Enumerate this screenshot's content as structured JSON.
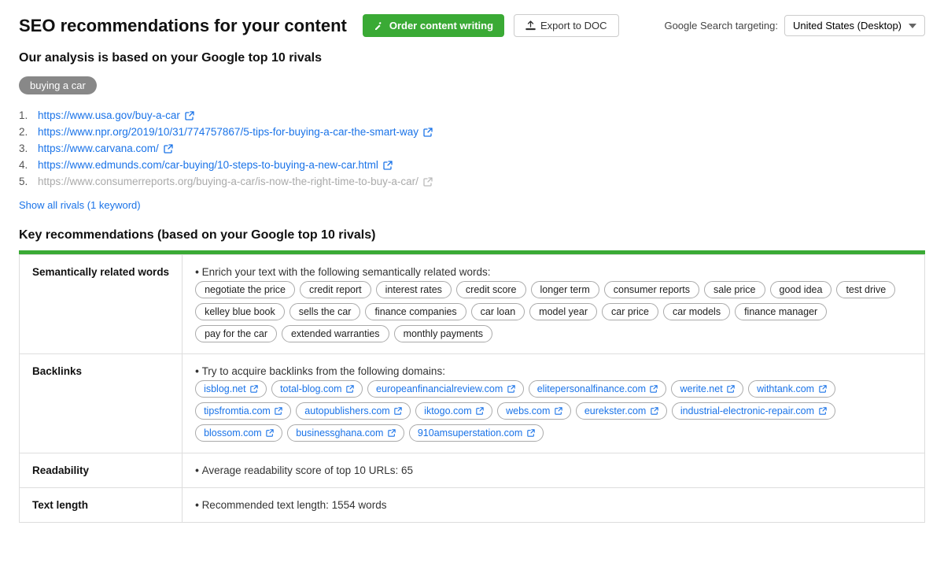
{
  "header": {
    "title": "SEO recommendations for your content",
    "order_btn": "Order content writing",
    "export_btn": "Export to DOC",
    "targeting_label": "Google Search targeting:",
    "targeting_value": "United States (Desktop)"
  },
  "analysis": {
    "subtitle": "Our analysis is based on your Google top 10 rivals",
    "keyword": "buying a car",
    "rivals": [
      {
        "num": "1.",
        "url": "https://www.usa.gov/buy-a-car",
        "dimmed": false
      },
      {
        "num": "2.",
        "url": "https://www.npr.org/2019/10/31/774757867/5-tips-for-buying-a-car-the-smart-way",
        "dimmed": false
      },
      {
        "num": "3.",
        "url": "https://www.carvana.com/",
        "dimmed": false
      },
      {
        "num": "4.",
        "url": "https://www.edmunds.com/car-buying/10-steps-to-buying-a-new-car.html",
        "dimmed": false
      },
      {
        "num": "5.",
        "url": "https://www.consumerreports.org/buying-a-car/is-now-the-right-time-to-buy-a-car/",
        "dimmed": true
      }
    ],
    "show_all": "Show all rivals (1 keyword)"
  },
  "recommendations": {
    "section_title": "Key recommendations (based on your Google top 10 rivals)",
    "rows": [
      {
        "label": "Semantically related words",
        "intro": "Enrich your text with the following semantically related words:",
        "type": "tags",
        "items": [
          "negotiate the price",
          "credit report",
          "interest rates",
          "credit score",
          "longer term",
          "consumer reports",
          "sale price",
          "good idea",
          "test drive",
          "kelley blue book",
          "sells the car",
          "finance companies",
          "car loan",
          "model year",
          "car price",
          "car models",
          "finance manager",
          "pay for the car",
          "extended warranties",
          "monthly payments"
        ]
      },
      {
        "label": "Backlinks",
        "intro": "Try to acquire backlinks from the following domains:",
        "type": "backlinks",
        "items": [
          "isblog.net",
          "total-blog.com",
          "europeanfinancialreview.com",
          "elitepersonalfinance.com",
          "werite.net",
          "withtank.com",
          "tipsfromtia.com",
          "autopublishers.com",
          "iktogo.com",
          "webs.com",
          "eurekster.com",
          "industrial-electronic-repair.com",
          "blossom.com",
          "businessghana.com",
          "910amsuperstation.com"
        ]
      },
      {
        "label": "Readability",
        "intro": "Average readability score of top 10 URLs:  65",
        "type": "text",
        "items": []
      },
      {
        "label": "Text length",
        "intro": "Recommended text length:  1554 words",
        "type": "text",
        "items": []
      }
    ]
  }
}
